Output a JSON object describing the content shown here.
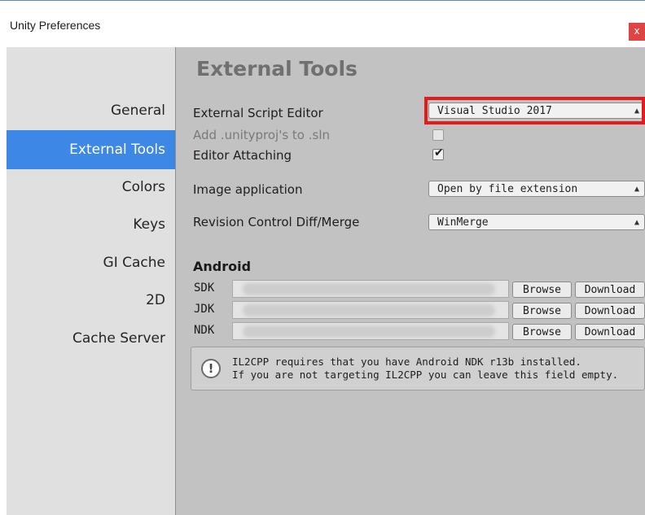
{
  "window": {
    "title": "Unity Preferences",
    "close_label": "x"
  },
  "sidebar": {
    "items": [
      {
        "label": "General"
      },
      {
        "label": "External Tools",
        "active": true
      },
      {
        "label": "Colors"
      },
      {
        "label": "Keys"
      },
      {
        "label": "GI Cache"
      },
      {
        "label": "2D"
      },
      {
        "label": "Cache Server"
      }
    ]
  },
  "main": {
    "heading": "External Tools",
    "script_editor": {
      "label": "External Script Editor",
      "value": "Visual Studio 2017"
    },
    "add_unityproj": {
      "label": "Add .unityproj's to .sln",
      "checked": false
    },
    "editor_attaching": {
      "label": "Editor Attaching",
      "checked": true
    },
    "image_application": {
      "label": "Image application",
      "value": "Open by file extension"
    },
    "revision_control": {
      "label": "Revision Control Diff/Merge",
      "value": "WinMerge"
    },
    "android": {
      "heading": "Android",
      "sdk": {
        "label": "SDK",
        "browse": "Browse",
        "download": "Download"
      },
      "jdk": {
        "label": "JDK",
        "browse": "Browse",
        "download": "Download"
      },
      "ndk": {
        "label": "NDK",
        "browse": "Browse",
        "download": "Download"
      }
    },
    "help": {
      "icon": "info-icon",
      "line1": "IL2CPP requires that you have Android NDK r13b installed.",
      "line2": "If you are not targeting IL2CPP you can leave this field empty."
    }
  },
  "colors": {
    "accent": "#3d87e6",
    "highlight": "#e51b1b",
    "close": "#e04343"
  }
}
